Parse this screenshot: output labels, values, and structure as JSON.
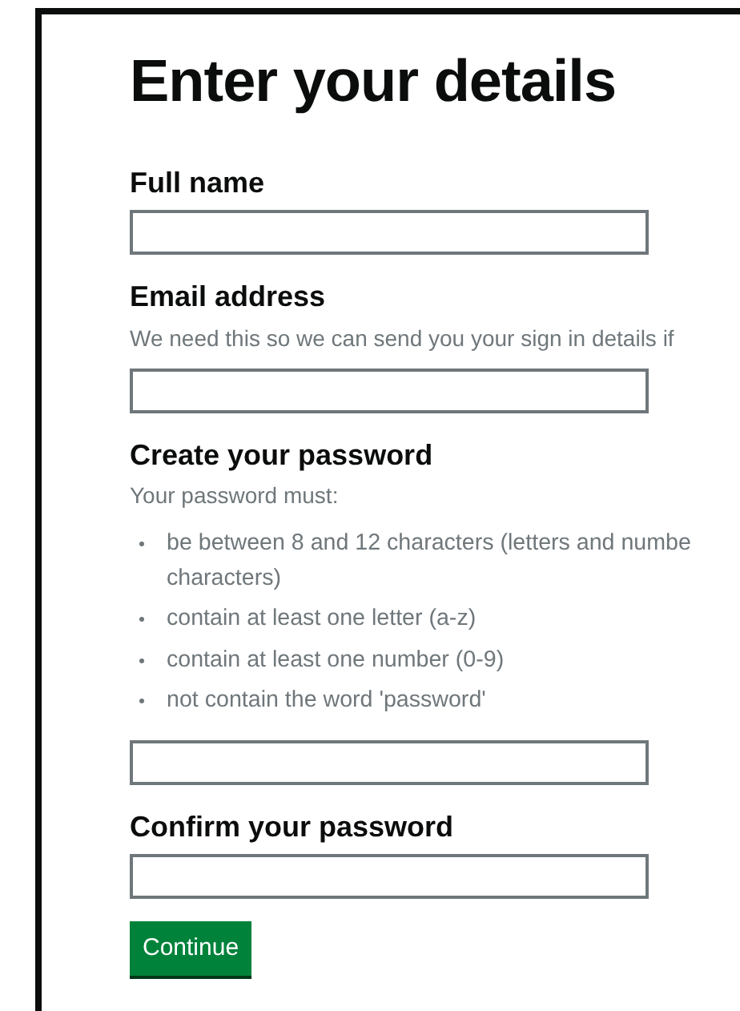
{
  "heading": "Enter your details",
  "fields": [
    {
      "kind": "text",
      "label": "Full name"
    },
    {
      "kind": "text",
      "label": "Email address",
      "hint": "We need this so we can send you your sign in details if"
    },
    {
      "kind": "rules",
      "label": "Create your password",
      "intro": "Your password must:",
      "rules": [
        {
          "lines": [
            "be between 8 and 12 characters (letters and numbe",
            "characters)"
          ]
        },
        {
          "lines": [
            "contain at least one letter (a-z)"
          ]
        },
        {
          "lines": [
            "contain at least one number (0-9)"
          ]
        },
        {
          "lines": [
            "not contain the word 'password'"
          ]
        }
      ]
    },
    {
      "kind": "text",
      "label": "Confirm your password"
    }
  ],
  "button": "Continue"
}
